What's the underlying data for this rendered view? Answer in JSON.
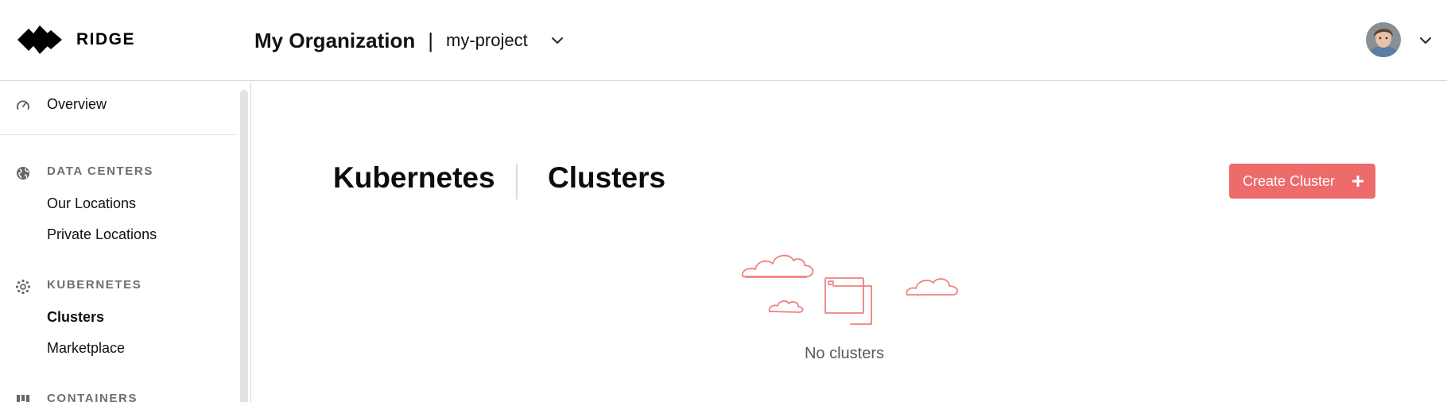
{
  "header": {
    "logo_text": "RIDGE",
    "organization": "My Organization",
    "separator": "|",
    "project": "my-project"
  },
  "sidebar": {
    "overview": "Overview",
    "sections": {
      "data_centers": {
        "title": "DATA CENTERS",
        "items": [
          "Our Locations",
          "Private Locations"
        ]
      },
      "kubernetes": {
        "title": "KUBERNETES",
        "items": [
          "Clusters",
          "Marketplace"
        ],
        "active": "Clusters"
      },
      "containers": {
        "title": "CONTAINERS"
      }
    }
  },
  "main": {
    "breadcrumb_parent": "Kubernetes",
    "breadcrumb_current": "Clusters",
    "create_button_label": "Create Cluster",
    "empty_state_text": "No clusters"
  },
  "colors": {
    "accent": "#ee6b6b",
    "section_title": "#6b6f75",
    "border": "#d6d6d6"
  },
  "icons": [
    "logo-mark",
    "chevron-down-icon",
    "speedometer-icon",
    "globe-icon",
    "kubernetes-icon",
    "containers-icon",
    "plus-icon",
    "empty-clouds-illustration"
  ]
}
